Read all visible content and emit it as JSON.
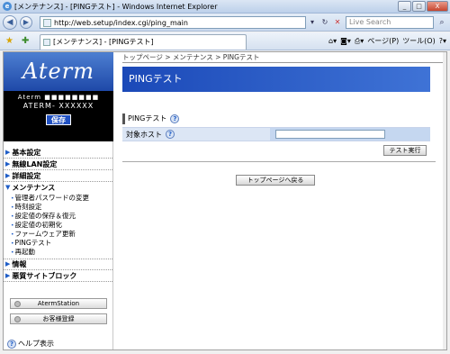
{
  "window": {
    "title": "[メンテナンス] - [PINGテスト] - Windows Internet Explorer",
    "minimize": "_",
    "maximize": "□",
    "close": "X"
  },
  "addressbar": {
    "url": "http://web.setup/index.cgi/ping_main",
    "search_placeholder": "Live Search"
  },
  "tabbar": {
    "tab_title": "[メンテナンス] - [PINGテスト]",
    "page_menu": "ページ(P)",
    "tools_menu": "ツール(O)"
  },
  "sidebar": {
    "brand": "Aterm",
    "device_line": "Aterm ■■■■■■■■",
    "model": "ATERM- XXXXXX",
    "save_label": "保存",
    "menu": [
      {
        "label": "基本設定"
      },
      {
        "label": "無線LAN設定"
      },
      {
        "label": "詳細設定"
      },
      {
        "label": "メンテナンス"
      }
    ],
    "maintenance_sub": [
      {
        "label": "管理者パスワードの変更"
      },
      {
        "label": "時刻設定"
      },
      {
        "label": "設定値の保存＆復元"
      },
      {
        "label": "設定値の初期化"
      },
      {
        "label": "ファームウェア更新"
      },
      {
        "label": "PINGテスト"
      },
      {
        "label": "再起動"
      }
    ],
    "menu_after": [
      {
        "label": "情報"
      },
      {
        "label": "悪質サイトブロック"
      }
    ],
    "aterm_station": "AtermStation",
    "customer_register": "お客様登録",
    "help": "ヘルプ表示"
  },
  "main": {
    "breadcrumb": "トップページ > メンテナンス > PINGテスト",
    "title": "PINGテスト",
    "section_title": "PINGテスト",
    "target_host_label": "対象ホスト",
    "target_host_value": "",
    "test_button": "テスト実行",
    "home_button": "トップページへ戻る"
  }
}
